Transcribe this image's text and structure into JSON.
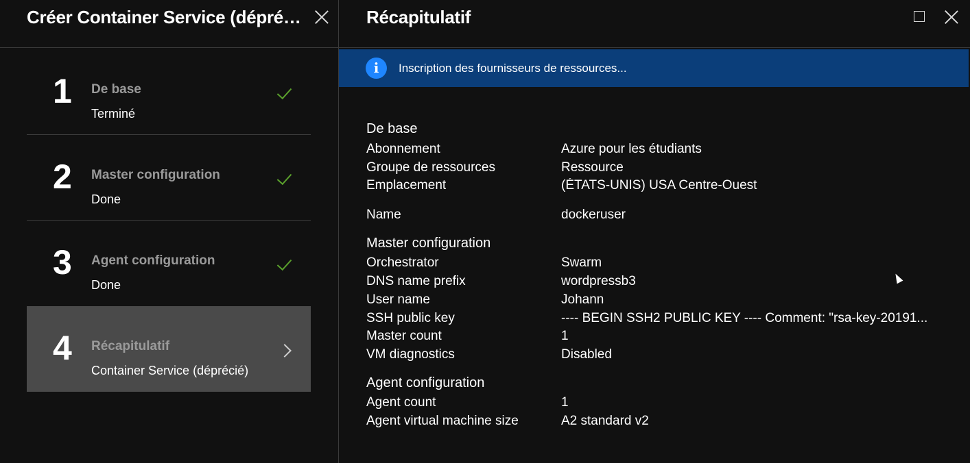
{
  "left_blade": {
    "title": "Créer Container Service (déprécié)",
    "steps": [
      {
        "number": "1",
        "title": "De base",
        "subtitle": "Terminé",
        "status": "done"
      },
      {
        "number": "2",
        "title": "Master configuration",
        "subtitle": "Done",
        "status": "done"
      },
      {
        "number": "3",
        "title": "Agent configuration",
        "subtitle": "Done",
        "status": "done"
      },
      {
        "number": "4",
        "title": "Récapitulatif",
        "subtitle": "Container Service (déprécié)",
        "status": "active"
      }
    ]
  },
  "right_blade": {
    "title": "Récapitulatif",
    "info_message": "Inscription des fournisseurs de ressources...",
    "sections": {
      "basics": {
        "title": "De base",
        "rows": [
          {
            "label": "Abonnement",
            "value": "Azure pour les étudiants"
          },
          {
            "label": "Groupe de ressources",
            "value": "Ressource"
          },
          {
            "label": "Emplacement",
            "value": "(ÉTATS-UNIS) USA Centre-Ouest"
          }
        ]
      },
      "name_row": {
        "label": "Name",
        "value": "dockeruser"
      },
      "master": {
        "title": "Master configuration",
        "rows": [
          {
            "label": "Orchestrator",
            "value": "Swarm"
          },
          {
            "label": "DNS name prefix",
            "value": "wordpressb3"
          },
          {
            "label": "User name",
            "value": "Johann"
          },
          {
            "label": "SSH public key",
            "value": "---- BEGIN SSH2 PUBLIC KEY ---- Comment: \"rsa-key-20191..."
          },
          {
            "label": "Master count",
            "value": "1"
          },
          {
            "label": "VM diagnostics",
            "value": "Disabled"
          }
        ]
      },
      "agent": {
        "title": "Agent configuration",
        "rows": [
          {
            "label": "Agent count",
            "value": "1"
          },
          {
            "label": "Agent virtual machine size",
            "value": "A2 standard v2"
          }
        ]
      }
    }
  },
  "colors": {
    "background": "#111111",
    "info_bar": "#0b3e7a",
    "info_icon": "#1f86ff",
    "check": "#5aa02c",
    "active_step": "#4a4a4a"
  }
}
